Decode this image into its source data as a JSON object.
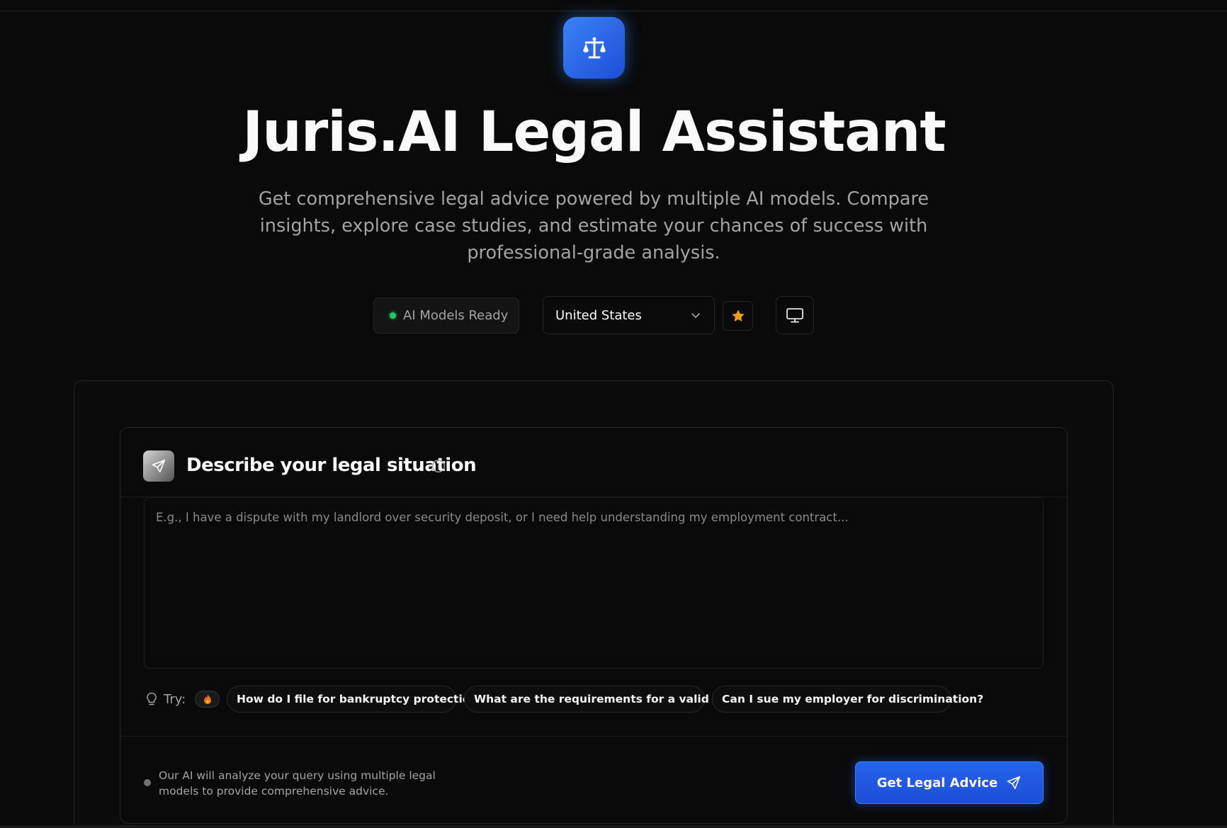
{
  "app": {
    "logo_icon": "scale-icon",
    "accent_color": "#2563eb",
    "title": "Juris.AI Legal Assistant",
    "subtitle": "Get comprehensive legal advice powered by multiple AI models. Compare insights, explore case studies, and estimate your chances of success with professional-grade analysis."
  },
  "controls": {
    "status_label": "AI Models Ready",
    "status_color": "#22c55e",
    "country_selected": "United States",
    "favorite_icon": "star-icon",
    "display_icon": "monitor-icon"
  },
  "query_card": {
    "title": "Describe your legal situation",
    "header_icon": "send-icon",
    "info_icon": "info-icon",
    "placeholder": "E.g., I have a dispute with my landlord over security deposit, or I need help understanding my employment contract...",
    "value": "",
    "try_label": "Try:",
    "suggestions": [
      "How do I file for bankruptcy protection?",
      "What are the requirements for a valid will?",
      "Can I sue my employer for discrimination?"
    ],
    "footer_note": "Our AI will analyze your query using multiple legal models to provide comprehensive advice.",
    "submit_label": "Get Legal Advice"
  }
}
